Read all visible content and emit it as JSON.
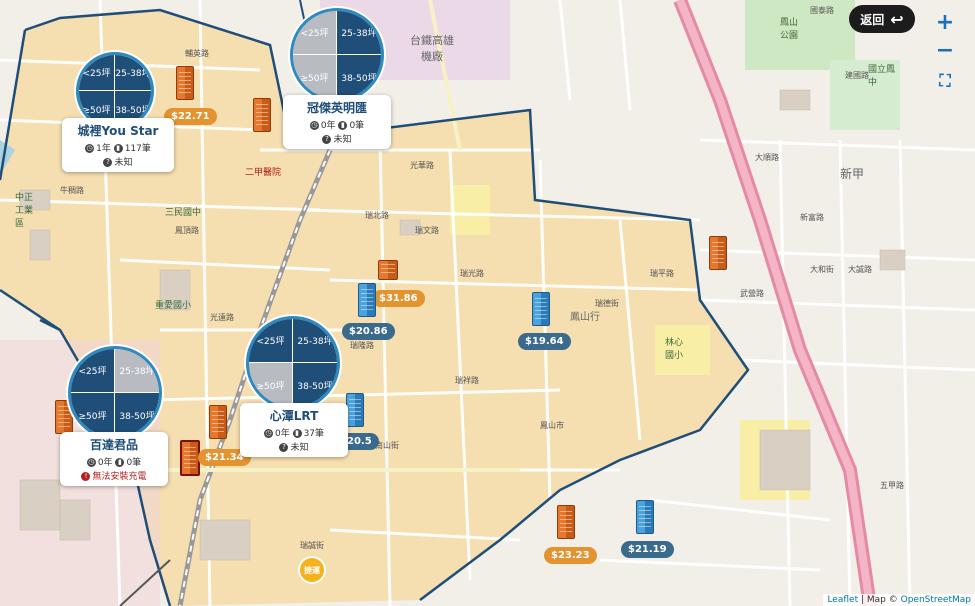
{
  "controls": {
    "back_label": "返回",
    "zoom_in": "+",
    "zoom_out": "−",
    "fullscreen": "⛶"
  },
  "attribution": {
    "leaflet": "Leaflet",
    "sep": "| Map ©",
    "osm": "OpenStreetMap"
  },
  "colors": {
    "boundary": "#1f4e79",
    "highlight_area": "#f5deb0",
    "orange_price": "#e3932f",
    "blue_price": "#3b6b8c",
    "pie_dark": "#1f4e79",
    "pie_light": "#b8bcc2"
  },
  "area_labels": {
    "taiwan_hsr": "台鐵高雄\n機廠",
    "xinjia": "新甲",
    "leimian": "鳳山\n公園",
    "national_hs": "國立鳳\n中",
    "sanmin": "三民國中",
    "fengshan_ji": "鳳山行",
    "ershan": "二甲醫院",
    "zhongzheng": "中正\n工業\n區",
    "haixing": "重愛國小",
    "linxian": "林心\n國小"
  },
  "streets": [
    "輔英路",
    "光華路",
    "牛稠路",
    "瑞北路",
    "瑞文路",
    "瑞光路",
    "瑞隆路",
    "瑞祥路",
    "瑞德街",
    "瑞平路",
    "鳳山市",
    "南山街",
    "國泰路",
    "大順路",
    "武營路",
    "建國路",
    "新富路",
    "大和街",
    "大誠路",
    "光遠路",
    "五甲路",
    "鳳頂路",
    "瑞誠街"
  ],
  "markers": [
    {
      "type": "orange",
      "price": "$22.71"
    },
    {
      "type": "orange",
      "price": ""
    },
    {
      "type": "orange",
      "price": "$31.86"
    },
    {
      "type": "blue",
      "price": "$20.86"
    },
    {
      "type": "blue",
      "price": "$19.64"
    },
    {
      "type": "orange",
      "price": ""
    },
    {
      "type": "blue",
      "price": "20.5"
    },
    {
      "type": "orange",
      "price": "$21.34"
    },
    {
      "type": "orange",
      "price": ""
    },
    {
      "type": "orange",
      "price": "$23.23"
    },
    {
      "type": "blue",
      "price": "$21.19"
    }
  ],
  "clusters": [
    {
      "name": "城裡You Star",
      "years": "1年",
      "count": "117筆",
      "status": "未知",
      "q": [
        "<25坪",
        "25-38坪",
        "≥50坪",
        "38-50坪"
      ],
      "shade": [
        "d",
        "d",
        "d",
        "d"
      ]
    },
    {
      "name": "冠傑英明匯",
      "years": "0年",
      "count": "0筆",
      "status": "未知",
      "q": [
        "<25坪",
        "25-38坪",
        "≥50坪",
        "38-50坪"
      ],
      "shade": [
        "l",
        "d",
        "l",
        "d"
      ]
    },
    {
      "name": "心潭LRT",
      "years": "0年",
      "count": "37筆",
      "status": "未知",
      "q": [
        "<25坪",
        "25-38坪",
        "≥50坪",
        "38-50坪"
      ],
      "shade": [
        "d",
        "d",
        "l",
        "d"
      ]
    },
    {
      "name": "百達君品",
      "years": "0年",
      "count": "0筆",
      "status": "無法安裝充電",
      "q": [
        "<25坪",
        "25-38坪",
        "≥50坪",
        "38-50坪"
      ],
      "shade": [
        "d",
        "l",
        "d",
        "d"
      ]
    }
  ],
  "mrt_label": "捷運"
}
